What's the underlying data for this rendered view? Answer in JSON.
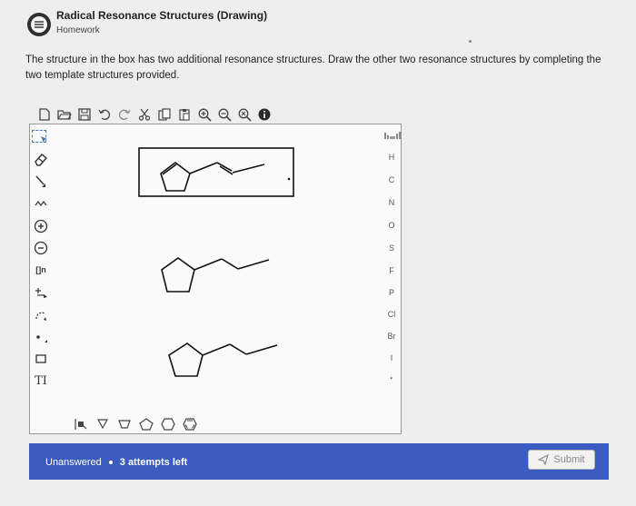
{
  "header": {
    "title": "Radical Resonance Structures (Drawing)",
    "subtitle": "Homework",
    "icon": "list-icon"
  },
  "question": {
    "text": "The structure in the box has two additional resonance structures. Draw the other two resonance structures by completing the two template structures provided."
  },
  "toolbar": {
    "icons": [
      "new-icon",
      "open-icon",
      "save-icon",
      "undo-icon",
      "redo-icon",
      "cut-icon",
      "copy-icon",
      "paste-icon",
      "zoom-in-icon",
      "zoom-out-icon",
      "zoom-fit-icon",
      "info-icon"
    ]
  },
  "left_tools": {
    "icons": [
      "select-icon",
      "eraser-icon",
      "single-bond-icon",
      "chain-icon",
      "charge-plus-icon",
      "charge-minus-icon",
      "bracket-icon",
      "reaction-arrow-icon",
      "curved-arrow-icon",
      "radical-dot-icon",
      "rectangle-icon",
      "text-tool-icon"
    ],
    "text_tool_label": "TI",
    "bracket_label": "[]n"
  },
  "right_tools": {
    "periodic_table_icon": "periodic-table-icon",
    "elements": [
      "H",
      "C",
      "N",
      "O",
      "S",
      "F",
      "P",
      "Cl",
      "Br",
      "I",
      "·"
    ]
  },
  "bottom_tools": {
    "icons": [
      "template-icon",
      "cyclopropane-icon",
      "cyclobutane-icon",
      "cyclopentane-icon",
      "cyclohexane-icon",
      "benzene-icon"
    ]
  },
  "footer": {
    "status": "Unanswered",
    "attempts": "3 attempts left",
    "submit_label": "Submit",
    "submit_icon": "send-icon"
  },
  "colors": {
    "footer_bg": "#3a5bbf",
    "selection": "#4a78b5"
  }
}
